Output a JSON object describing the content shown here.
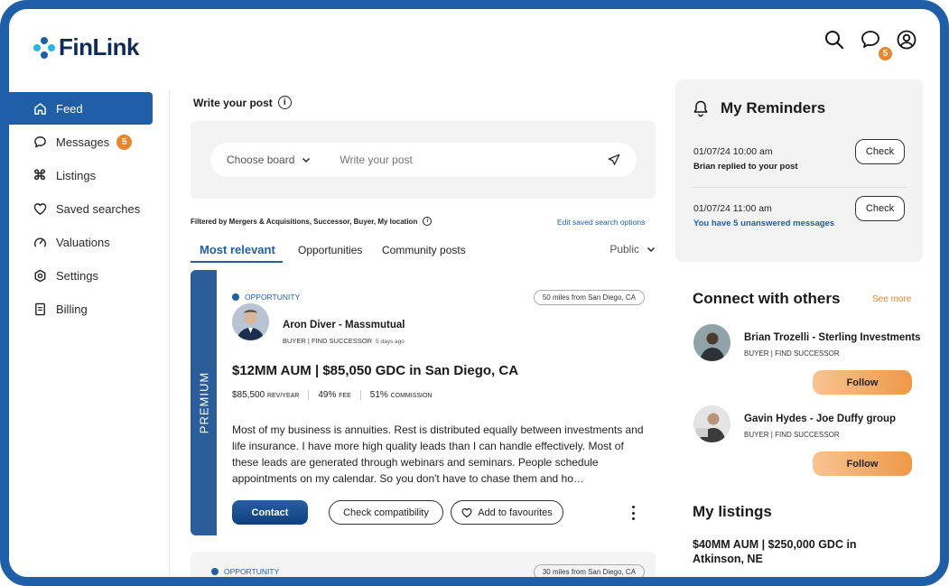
{
  "app": {
    "name": "FinLink",
    "brand_color": "#1f5fa8",
    "accent_color": "#e9852d"
  },
  "header": {
    "icons": [
      "search-icon",
      "chat-icon",
      "user-icon"
    ],
    "messages_badge": "5"
  },
  "sidebar": {
    "items": [
      {
        "label": "Feed",
        "icon": "home-icon",
        "active": true
      },
      {
        "label": "Messages",
        "icon": "message-icon",
        "badge": "5"
      },
      {
        "label": "Listings",
        "icon": "command-icon"
      },
      {
        "label": "Saved searches",
        "icon": "heart-icon"
      },
      {
        "label": "Valuations",
        "icon": "gauge-icon"
      },
      {
        "label": "Settings",
        "icon": "gear-icon"
      },
      {
        "label": "Billing",
        "icon": "document-icon"
      }
    ]
  },
  "composer": {
    "title": "Write your post",
    "info_glyph": "i",
    "board_label": "Choose board",
    "post_placeholder": "Write your post"
  },
  "filter": {
    "text": "Filtered by Mergers & Acquisitions, Successor, Buyer, My location",
    "edit_link": "Edit saved search options"
  },
  "tabs": {
    "items": [
      "Most relevant",
      "Opportunities",
      "Community posts"
    ],
    "visibility": "Public"
  },
  "post": {
    "badge": "PREMIUM",
    "tag": "OPPORTUNITY",
    "distance": "50 miles from San Diego, CA",
    "author": "Aron Diver - Massmutual",
    "role": "BUYER | FIND SUCCESSOR",
    "ago": "5 days ago",
    "title": "$12MM AUM | $85,050 GDC in San Diego, CA",
    "stats": [
      {
        "value": "$85,500",
        "unit": "REV/YEAR"
      },
      {
        "value": "49%",
        "unit": "FEE"
      },
      {
        "value": "51%",
        "unit": "COMMISSION"
      }
    ],
    "body": "Most of my business is annuities. Rest is distributed equally between investments and life insurance. I have more high quality leads than I can handle effectively. Most of these leads are generated through webinars and seminars. People schedule appointments on my calendar. So you don't have to chase them and ho…",
    "actions": {
      "contact": "Contact",
      "compat": "Check compatibility",
      "favourite": "Add to favourites"
    }
  },
  "post2": {
    "tag": "OPPORTUNITY",
    "distance": "30 miles from San Diego, CA"
  },
  "reminders": {
    "title": "My Reminders",
    "items": [
      {
        "date": "01/07/24  10:00 am",
        "message": "Brian replied to your post",
        "button": "Check"
      },
      {
        "date": "01/07/24  11:00 am",
        "message": "You have 5 unanswered messages",
        "button": "Check"
      }
    ]
  },
  "connect": {
    "title": "Connect with others",
    "see_more": "See more",
    "people": [
      {
        "name": "Brian Trozelli - Sterling Investments",
        "role": "BUYER | FIND SUCCESSOR",
        "button": "Follow"
      },
      {
        "name": "Gavin Hydes - Joe Duffy group",
        "role": "BUYER | FIND SUCCESSOR",
        "button": "Follow"
      }
    ]
  },
  "listings": {
    "title": "My listings",
    "first_title": "$40MM AUM | $250,000 GDC in Atkinson, NE"
  }
}
